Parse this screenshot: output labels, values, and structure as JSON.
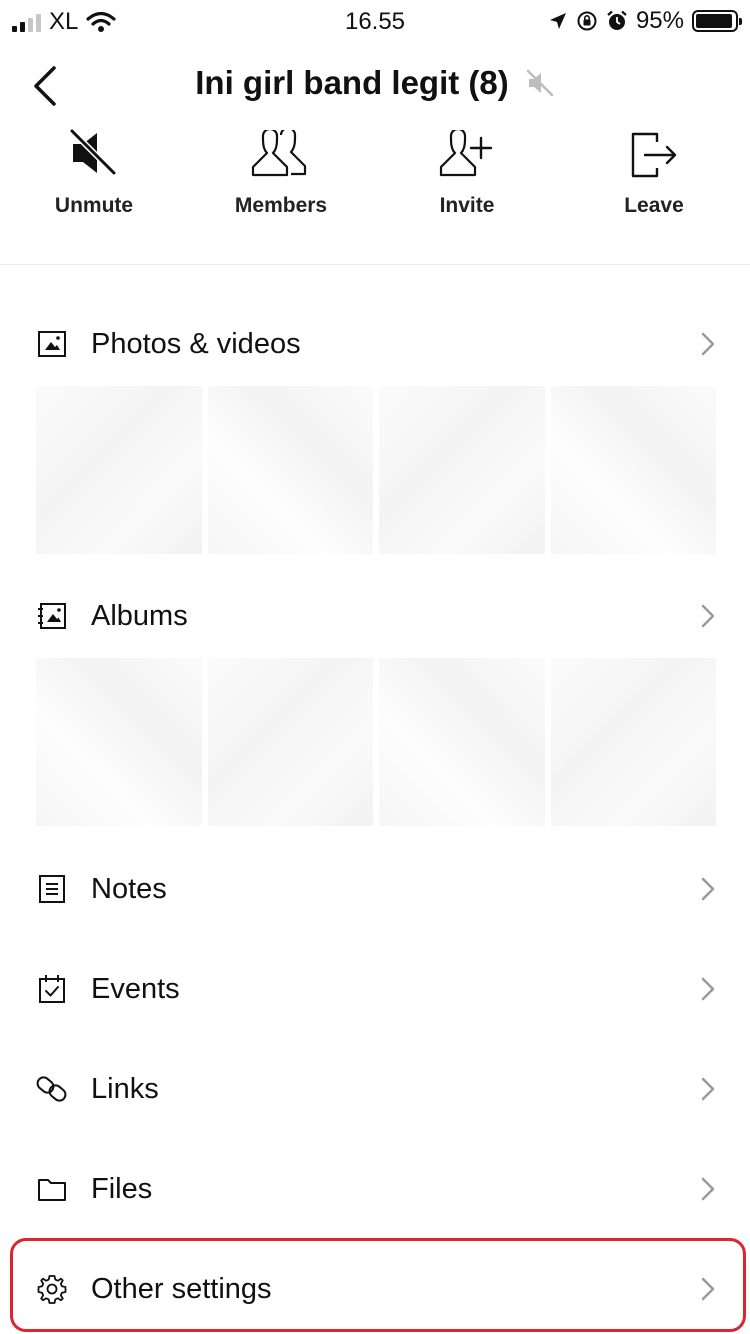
{
  "status_bar": {
    "carrier": "XL",
    "time": "16.55",
    "battery_percent": "95%",
    "battery_level": 0.95
  },
  "header": {
    "title": "Ini girl band legit (8)",
    "icons": [
      "back-chevron-icon",
      "muted-speaker-icon"
    ]
  },
  "actions": [
    {
      "label": "Unmute",
      "icon": "unmute-speaker-icon"
    },
    {
      "label": "Members",
      "icon": "members-icon"
    },
    {
      "label": "Invite",
      "icon": "invite-person-icon"
    },
    {
      "label": "Leave",
      "icon": "leave-door-icon"
    }
  ],
  "menu": {
    "photos": {
      "label": "Photos & videos",
      "icon": "photo-icon"
    },
    "albums": {
      "label": "Albums",
      "icon": "album-icon"
    },
    "notes": {
      "label": "Notes",
      "icon": "note-icon"
    },
    "events": {
      "label": "Events",
      "icon": "calendar-check-icon"
    },
    "links": {
      "label": "Links",
      "icon": "link-icon"
    },
    "files": {
      "label": "Files",
      "icon": "folder-icon"
    },
    "other_settings": {
      "label": "Other settings",
      "icon": "gear-icon"
    }
  },
  "colors": {
    "highlight": "#d9262f",
    "text": "#111111",
    "chevron": "#9a9a9a"
  }
}
